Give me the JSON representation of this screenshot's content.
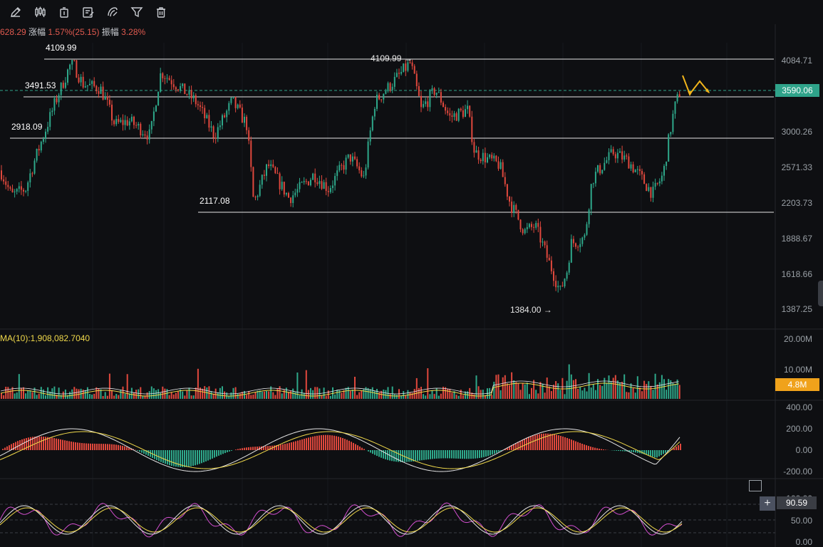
{
  "toolbar": {
    "icons": [
      "pencil-icon",
      "candlestick-icon",
      "delete-object-icon",
      "note-icon",
      "magnet-icon",
      "filter-icon",
      "trash-icon"
    ]
  },
  "info": {
    "prefix": "628.29",
    "change_label": "涨幅",
    "change_value": "1.57%(25.15)",
    "amp_label": "振幅",
    "amp_value": "3.28%"
  },
  "volume_label": "MA(10):1,908,082.7040",
  "colors": {
    "up": "#2ea88a",
    "down": "#e0483d",
    "price_tag": "#2fa38a",
    "vol_tag": "#f0a21b",
    "yellow": "#f0d94b",
    "magenta": "#d44fd0"
  },
  "chart_data": {
    "type": "candlestick",
    "price": {
      "current": "3590.06",
      "price_axis_ticks": [
        "4084.71",
        "3000.26",
        "2571.33",
        "2203.73",
        "1888.67",
        "1618.66",
        "1387.25"
      ],
      "horizontal_levels": [
        {
          "value": 4109.99,
          "label": "4109.99"
        },
        {
          "value": 3491.53,
          "label": "3491.53"
        },
        {
          "value": 2918.09,
          "label": "2918.09"
        },
        {
          "value": 2117.08,
          "label": "2117.08"
        }
      ],
      "annotations": [
        {
          "label": "4109.99",
          "kind": "high",
          "ref": "4109.99 →"
        },
        {
          "label": "1384.00",
          "kind": "low",
          "ref": "1384.00 →"
        }
      ],
      "ylim": [
        1300,
        4200
      ]
    },
    "volume": {
      "axis_ticks": [
        "20.00M",
        "10.00M"
      ],
      "current": "4.8M",
      "ma_label": "MA(10):1,908,082.7040"
    },
    "macd": {
      "axis_ticks": [
        "400.00",
        "200.00",
        "0.00",
        "-200.00"
      ]
    },
    "stoch": {
      "axis_ticks": [
        "100.00",
        "50.00",
        "0.00"
      ],
      "current": "90.59"
    }
  }
}
